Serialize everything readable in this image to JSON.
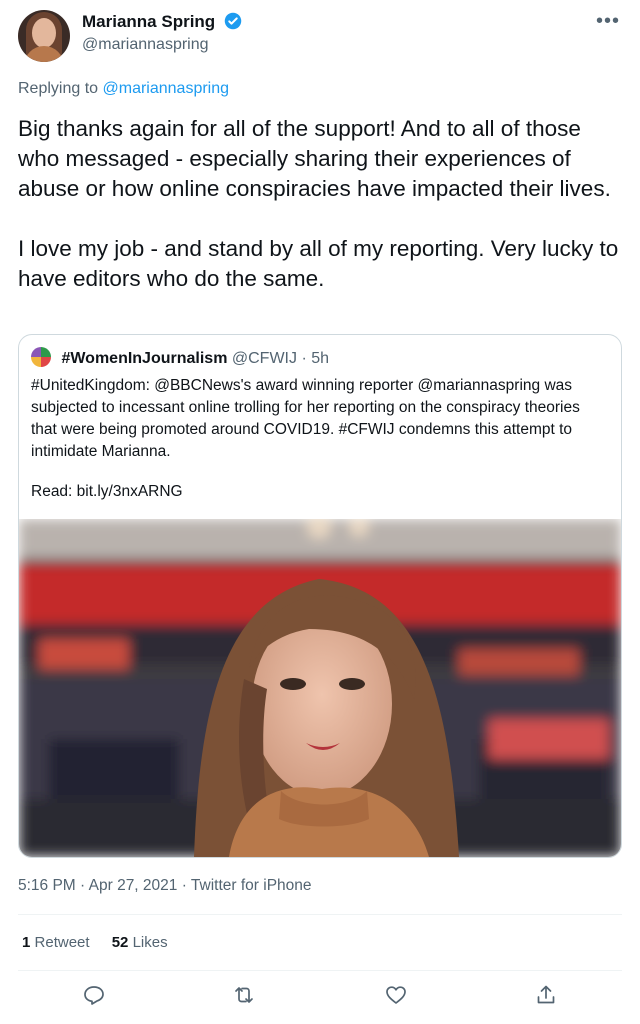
{
  "author": {
    "name": "Marianna Spring",
    "handle": "@mariannaspring"
  },
  "reply": {
    "prefix": "Replying to",
    "to": "@mariannaspring"
  },
  "tweet": {
    "paragraph1": "Big thanks again for all of the support! And to all of those who messaged - especially sharing their experiences of abuse or how online conspiracies have impacted their lives.",
    "paragraph2": "I love my job - and stand by all of my reporting. Very lucky to have editors who do the same."
  },
  "quote": {
    "name": "#WomenInJournalism",
    "handle": "@CFWIJ",
    "time": "· 5h",
    "text": "#UnitedKingdom: @BBCNews's award winning reporter @mariannaspring was subjected to incessant online trolling for her reporting on the conspiracy theories that were being promoted around COVID19. #CFWIJ condemns this attempt to intimidate Marianna.",
    "read": "Read: bit.ly/3nxARNG"
  },
  "meta": "5:16 PM · Apr 27, 2021 · Twitter for iPhone",
  "stats": {
    "retweets_count": "1",
    "retweets_label": "Retweet",
    "likes_count": "52",
    "likes_label": "Likes"
  },
  "actions": [
    "reply-icon",
    "retweet-icon",
    "like-icon",
    "share-icon"
  ],
  "colors": {
    "accent": "#1d9bf0",
    "muted": "#536471",
    "text": "#0f1419"
  }
}
